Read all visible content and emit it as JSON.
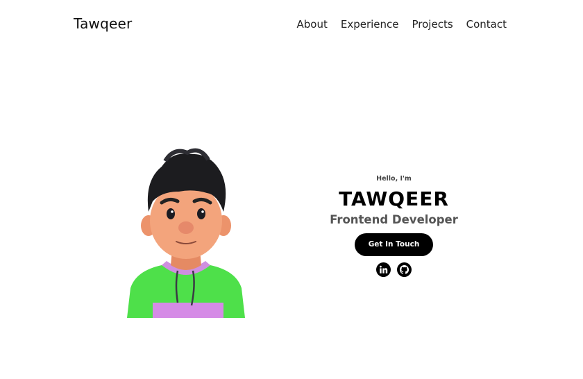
{
  "nav": {
    "logo": "Tawqeer",
    "links": [
      "About",
      "Experience",
      "Projects",
      "Contact"
    ]
  },
  "hero": {
    "greeting": "Hello, I'm",
    "name": "TAWQEER",
    "role": "Frontend Developer",
    "cta_label": "Get In Touch",
    "avatar_icon": "avatar-3d-character",
    "socials": [
      "linkedin-icon",
      "github-icon"
    ]
  },
  "colors": {
    "background": "#ffffff",
    "button": "#000000",
    "button_text": "#ffffff",
    "role_text": "#555555",
    "hoodie_green": "#4ee04a",
    "hoodie_purple": "#d58be6",
    "skin": "#f0a27a",
    "hair": "#1c1c1f"
  }
}
